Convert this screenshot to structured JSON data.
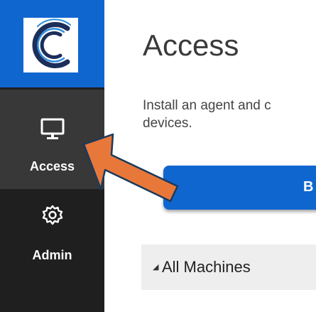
{
  "sidebar": {
    "items": [
      {
        "label": "Access",
        "icon": "monitor-icon",
        "active": true
      },
      {
        "label": "Admin",
        "icon": "gear-icon",
        "active": false
      }
    ]
  },
  "main": {
    "title": "Access",
    "description_line1": "Install an agent and c",
    "description_line2": "devices.",
    "primary_button_label": "B",
    "group": {
      "caret": "◢",
      "label": "All Machines"
    }
  },
  "colors": {
    "brand_blue": "#1066cf",
    "sidebar_bg": "#1f1f1f",
    "active_item_bg": "#383838",
    "annotation_arrow": "#e8783a"
  }
}
